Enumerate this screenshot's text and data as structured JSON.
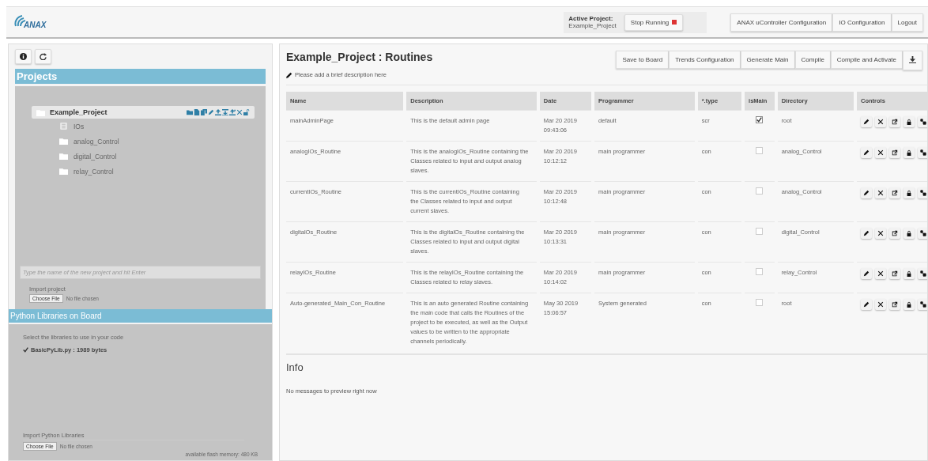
{
  "header": {
    "logo_text": "ANAX",
    "active_project_label": "Active Project:",
    "active_project_name": "Example_Project",
    "stop_button": "Stop Running",
    "nav_buttons": [
      "ANAX uController Configuration",
      "IO Configuration",
      "Logout"
    ]
  },
  "sidebar": {
    "projects_title": "Projects",
    "tree": [
      {
        "label": "Example_Project",
        "selected": true,
        "expanded": true,
        "children": [
          {
            "label": "IOs",
            "kind": "io"
          },
          {
            "label": "analog_Control",
            "kind": "folder"
          },
          {
            "label": "digital_Control",
            "kind": "folder"
          },
          {
            "label": "relay_Control",
            "kind": "folder"
          }
        ]
      }
    ],
    "new_project_placeholder": "Type the name of the new project and hit Enter",
    "import_project_label": "Import project",
    "import_project_button": "Choose File",
    "import_project_status": "No file chosen",
    "libraries_title": "Python Libraries on Board",
    "libraries_hint": "Select the libraries to use in your code",
    "libraries": [
      {
        "label": "BasicPyLib.py : 1989 bytes",
        "checked": true
      }
    ],
    "import_libraries_label": "Import Python Libraries",
    "import_libraries_button": "Choose File",
    "import_libraries_status": "No file chosen",
    "memory": "available flash memory: 480 KB"
  },
  "main": {
    "title": "Example_Project : Routines",
    "description_hint": "Please add a brief description here",
    "toolbar": [
      "Save to Board",
      "Trends Configuration",
      "Generate Main",
      "Compile",
      "Compile and Activate"
    ],
    "table": {
      "columns": [
        "Name",
        "Description",
        "Date",
        "Programmer",
        "*.type",
        "isMain",
        "Directory",
        "Controls"
      ],
      "rows": [
        {
          "name": "mainAdminPage",
          "description": "This is the default admin page",
          "date": "Mar 20 2019",
          "time": "09:43:06",
          "programmer": "default",
          "type": "scr",
          "is_main": true,
          "directory": "root"
        },
        {
          "name": "analogIOs_Routine",
          "description": "This is the analogIOs_Routine containing the Classes related to input and output analog slaves.",
          "date": "Mar 20 2019",
          "time": "10:12:12",
          "programmer": "main programmer",
          "type": "con",
          "is_main": false,
          "directory": "analog_Control"
        },
        {
          "name": "currentIOs_Routine",
          "description": "This is the currentIOs_Routine containing the Classes related to input and output current slaves.",
          "date": "Mar 20 2019",
          "time": "10:12:48",
          "programmer": "main programmer",
          "type": "con",
          "is_main": false,
          "directory": "analog_Control"
        },
        {
          "name": "digitalOs_Routine",
          "description": "This is the digitalOs_Routine containing the Classes related to input and output digital slaves.",
          "date": "Mar 20 2019",
          "time": "10:13:31",
          "programmer": "main programmer",
          "type": "con",
          "is_main": false,
          "directory": "digital_Control"
        },
        {
          "name": "relayIOs_Routine",
          "description": "This is the relayIOs_Routine containing the Classes related to relay slaves.",
          "date": "Mar 20 2019",
          "time": "10:14:02",
          "programmer": "main programmer",
          "type": "con",
          "is_main": false,
          "directory": "relay_Control"
        },
        {
          "name": "Auto-generated_Main_Con_Routine",
          "description": "This is an auto generated Routine containing the main code that calls the Routines of the project to be executed, as well as the Output values to be written to the appropriate channels periodically.",
          "date": "May 30 2019",
          "time": "15:06:57",
          "programmer": "System generated",
          "type": "con",
          "is_main": false,
          "directory": "root"
        }
      ]
    },
    "info_title": "Info",
    "info_message": "No messages to preview right now"
  }
}
